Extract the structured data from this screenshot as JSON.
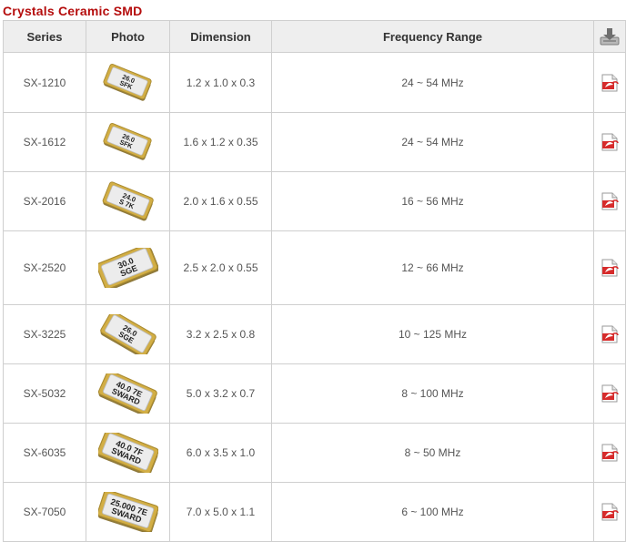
{
  "title": "Crystals  Ceramic SMD",
  "headers": {
    "series": "Series",
    "photo": "Photo",
    "dimension": "Dimension",
    "frequency": "Frequency Range",
    "download_icon": "download-icon"
  },
  "rows": [
    {
      "series": "SX-1210",
      "dimension": "1.2 x 1.0 x 0.3",
      "frequency": "24 ~ 54 MHz",
      "marking": [
        "26.0",
        "SFK"
      ],
      "icon": "pdf-icon"
    },
    {
      "series": "SX-1612",
      "dimension": "1.6 x 1.2 x 0.35",
      "frequency": "24 ~ 54 MHz",
      "marking": [
        "26.0",
        "SFK"
      ],
      "icon": "pdf-icon"
    },
    {
      "series": "SX-2016",
      "dimension": "2.0 x 1.6 x 0.55",
      "frequency": "16 ~ 56 MHz",
      "marking": [
        "24.0",
        "S 7K"
      ],
      "icon": "pdf-icon"
    },
    {
      "series": "SX-2520",
      "dimension": "2.5 x 2.0 x 0.55",
      "frequency": "12 ~ 66 MHz",
      "marking": [
        "30.0",
        "SGE"
      ],
      "icon": "pdf-icon"
    },
    {
      "series": "SX-3225",
      "dimension": "3.2 x 2.5 x 0.8",
      "frequency": "10 ~ 125 MHz",
      "marking": [
        "26.0",
        "SGE"
      ],
      "icon": "pdf-icon"
    },
    {
      "series": "SX-5032",
      "dimension": "5.0 x 3.2 x 0.7",
      "frequency": "8 ~ 100 MHz",
      "marking": [
        "40.0 7E",
        "SWARD"
      ],
      "icon": "pdf-icon"
    },
    {
      "series": "SX-6035",
      "dimension": "6.0 x 3.5 x 1.0",
      "frequency": "8 ~ 50 MHz",
      "marking": [
        "40.0 7F",
        "SWARD"
      ],
      "icon": "pdf-icon"
    },
    {
      "series": "SX-7050",
      "dimension": "7.0 x 5.0 x 1.1",
      "frequency": "6 ~ 100 MHz",
      "marking": [
        "25.000 7E",
        "SWARD"
      ],
      "icon": "pdf-icon"
    }
  ],
  "colors": {
    "title": "#b50d0d",
    "header_bg": "#eeeeee",
    "border": "#cfcfcf",
    "pdf_red": "#d62b2b",
    "chip_gold": "#c9a33a"
  }
}
